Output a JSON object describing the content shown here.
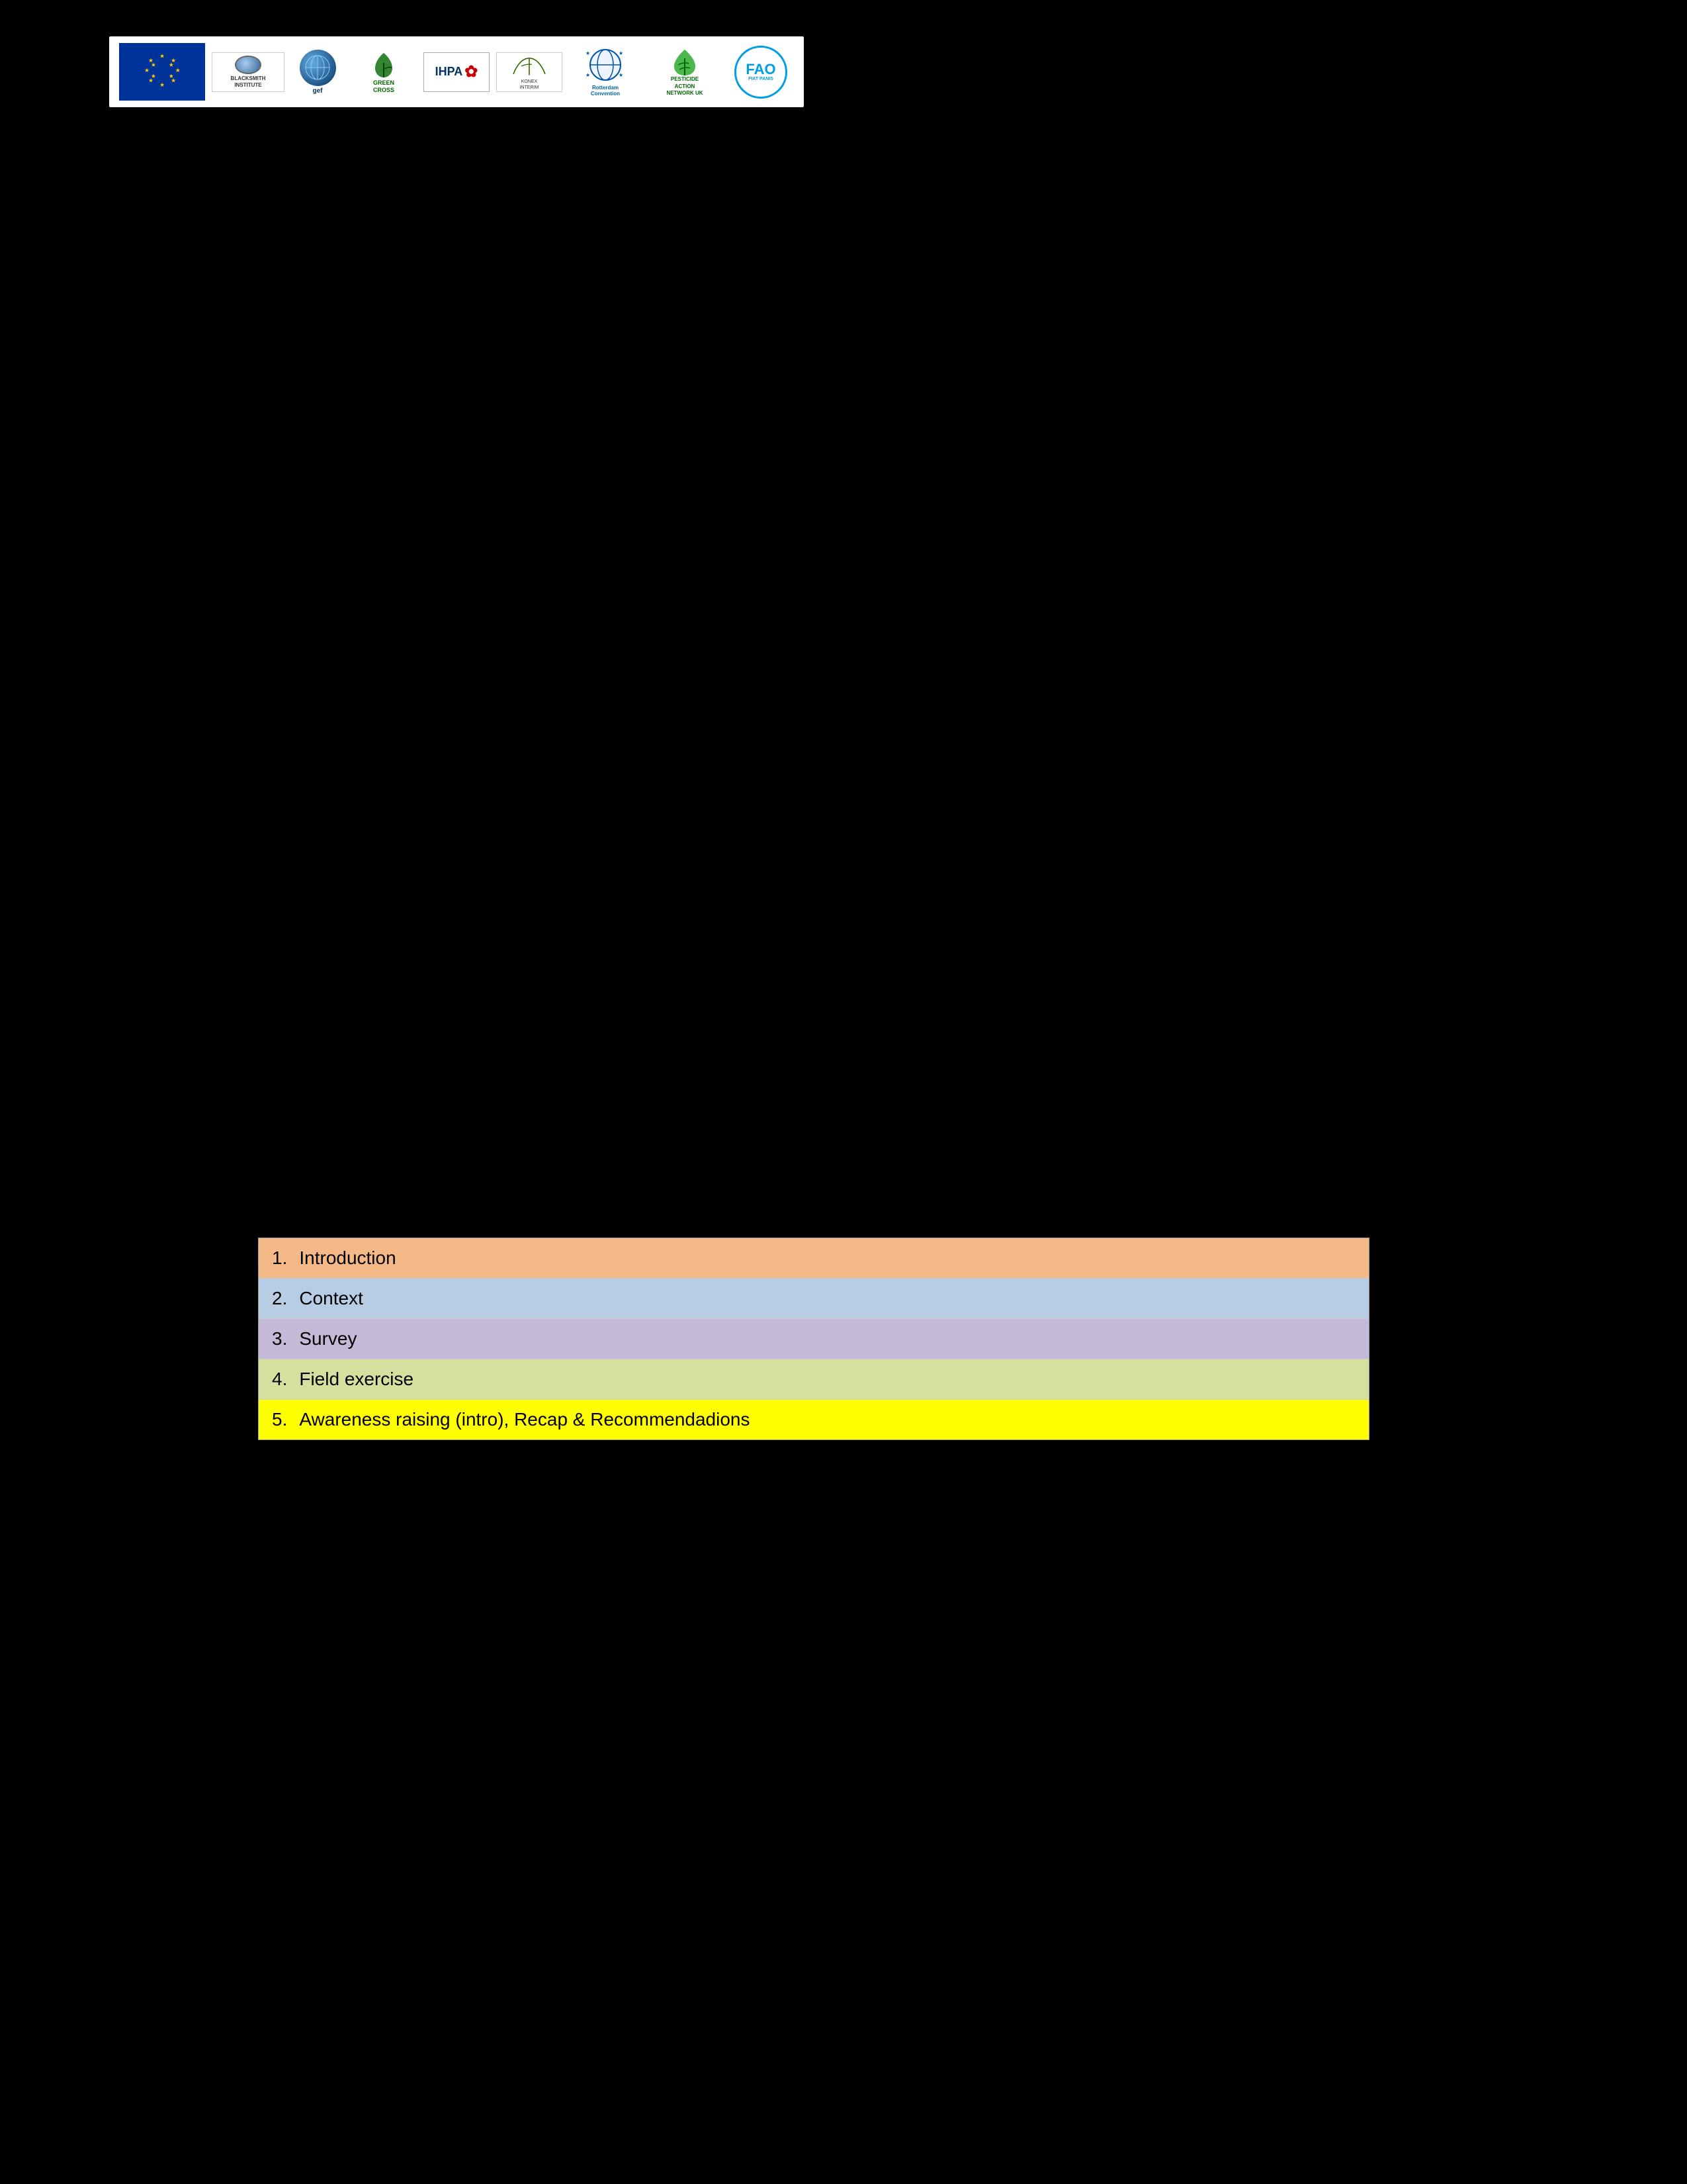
{
  "header": {
    "logos": [
      {
        "name": "eu-flag",
        "label": "European Union Flag"
      },
      {
        "name": "blacksmith-institute",
        "label": "Blacksmith Institute"
      },
      {
        "name": "gef",
        "label": "GEF - Global Environment Facility"
      },
      {
        "name": "green-cross",
        "label": "Green Cross"
      },
      {
        "name": "ihpa",
        "label": "IHPA"
      },
      {
        "name": "konex",
        "label": "Konex Interim"
      },
      {
        "name": "rotterdam-convention",
        "label": "Rotterdam Convention"
      },
      {
        "name": "pan-uk",
        "label": "Pesticide Action Network UK"
      },
      {
        "name": "fao",
        "label": "FAO - FIAT PANIS"
      }
    ]
  },
  "menu": {
    "items": [
      {
        "number": "1.",
        "label": "Introduction",
        "color": "#f4b986"
      },
      {
        "number": "2.",
        "label": "Context",
        "color": "#b8cce4"
      },
      {
        "number": "3.",
        "label": "Survey",
        "color": "#c4b9d6"
      },
      {
        "number": "4.",
        "label": "Field exercise",
        "color": "#d6df9e"
      },
      {
        "number": "5.",
        "label": "Awareness raising (intro), Recap & Recommendadions",
        "color": "#ffff00"
      }
    ]
  },
  "background_color": "#000000"
}
